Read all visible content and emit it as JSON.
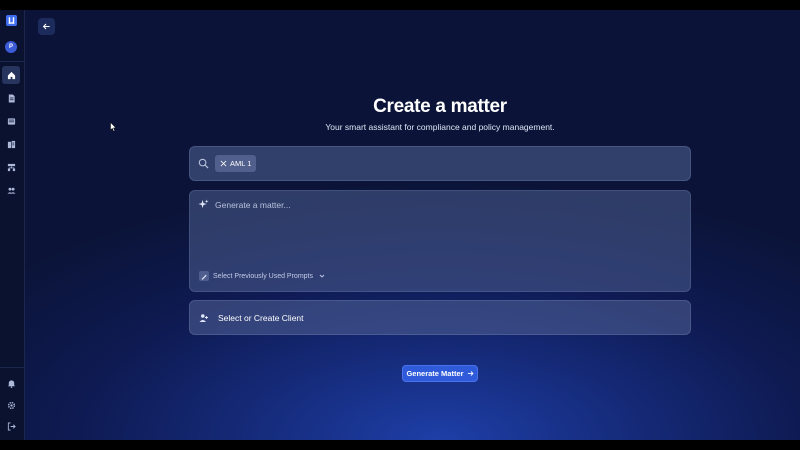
{
  "sidebar": {
    "avatar_initial": "P",
    "nav": [
      {
        "name": "home",
        "active": true
      },
      {
        "name": "documents",
        "active": false
      },
      {
        "name": "reports",
        "active": false
      },
      {
        "name": "library",
        "active": false
      },
      {
        "name": "organization",
        "active": false
      },
      {
        "name": "users",
        "active": false
      }
    ],
    "bottom": [
      "notifications",
      "settings",
      "logout"
    ]
  },
  "main": {
    "title": "Create a matter",
    "subtitle": "Your smart assistant for compliance and policy management.",
    "search": {
      "chip_label": "AML 1"
    },
    "prompt": {
      "placeholder": "Generate a matter...",
      "value": "",
      "previous_prompts_label": "Select Previously Used Prompts"
    },
    "client": {
      "label": "Select or Create Client"
    },
    "generate_button": "Generate Matter"
  },
  "colors": {
    "accent": "#2f5ad9",
    "sidebar_bg": "#0b1230",
    "card_bg": "#4d5c8c"
  }
}
